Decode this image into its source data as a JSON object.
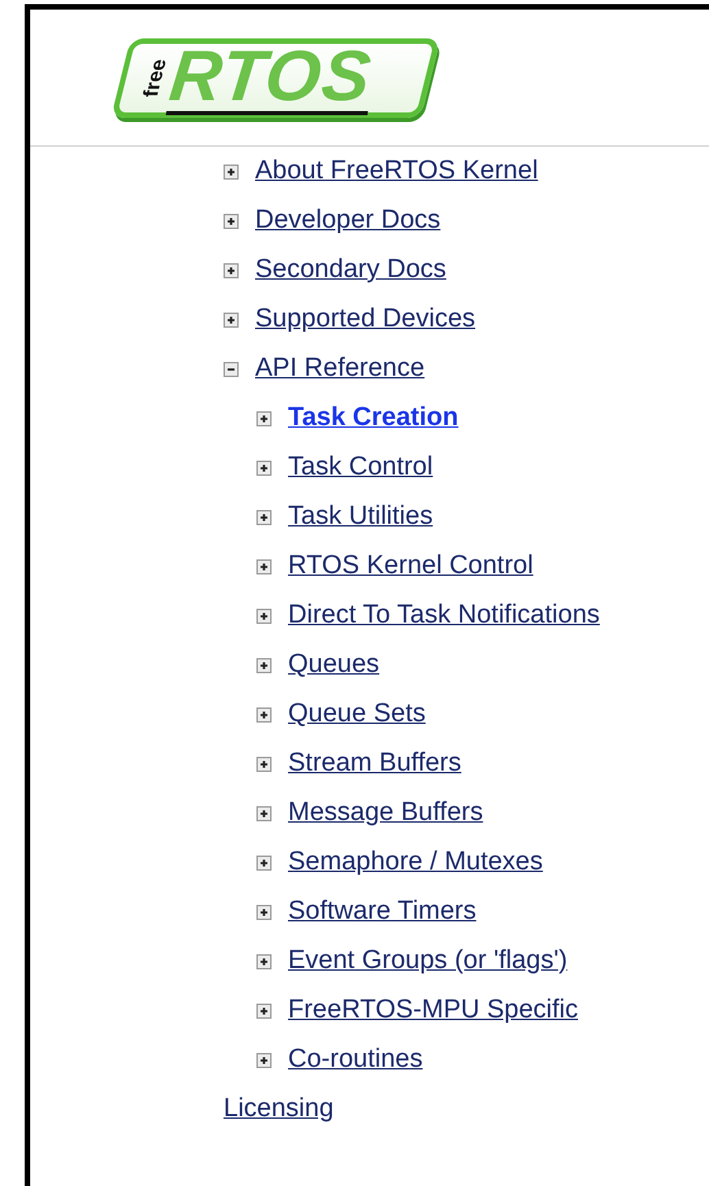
{
  "logo": {
    "small": "free",
    "large": "RTOS"
  },
  "nav": [
    {
      "label": "About FreeRTOS Kernel",
      "kind": "node",
      "expanded": false,
      "selected": false
    },
    {
      "label": "Developer Docs",
      "kind": "node",
      "expanded": false,
      "selected": false
    },
    {
      "label": "Secondary Docs",
      "kind": "node",
      "expanded": false,
      "selected": false
    },
    {
      "label": "Supported Devices",
      "kind": "node",
      "expanded": false,
      "selected": false
    },
    {
      "label": "API Reference",
      "kind": "node",
      "expanded": true,
      "selected": false,
      "children": [
        {
          "label": "Task Creation",
          "kind": "node",
          "expanded": false,
          "selected": true
        },
        {
          "label": "Task Control",
          "kind": "node",
          "expanded": false,
          "selected": false
        },
        {
          "label": "Task Utilities",
          "kind": "node",
          "expanded": false,
          "selected": false
        },
        {
          "label": "RTOS Kernel Control",
          "kind": "node",
          "expanded": false,
          "selected": false
        },
        {
          "label": "Direct To Task Notifications",
          "kind": "node",
          "expanded": false,
          "selected": false
        },
        {
          "label": "Queues",
          "kind": "node",
          "expanded": false,
          "selected": false
        },
        {
          "label": "Queue Sets",
          "kind": "node",
          "expanded": false,
          "selected": false
        },
        {
          "label": "Stream Buffers",
          "kind": "node",
          "expanded": false,
          "selected": false
        },
        {
          "label": "Message Buffers",
          "kind": "node",
          "expanded": false,
          "selected": false
        },
        {
          "label": "Semaphore / Mutexes",
          "kind": "node",
          "expanded": false,
          "selected": false
        },
        {
          "label": "Software Timers",
          "kind": "node",
          "expanded": false,
          "selected": false
        },
        {
          "label": "Event Groups (or 'flags')",
          "kind": "node",
          "expanded": false,
          "selected": false
        },
        {
          "label": "FreeRTOS-MPU Specific",
          "kind": "node",
          "expanded": false,
          "selected": false
        },
        {
          "label": "Co-routines",
          "kind": "node",
          "expanded": false,
          "selected": false
        }
      ]
    },
    {
      "label": "Licensing",
      "kind": "leaf",
      "selected": false
    }
  ]
}
